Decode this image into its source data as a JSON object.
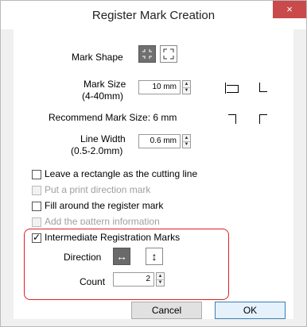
{
  "window": {
    "title": "Register Mark Creation",
    "close_glyph": "×"
  },
  "mark_shape": {
    "label": "Mark Shape",
    "options": [
      "corner-marks-icon",
      "crop-marks-icon"
    ],
    "selected_index": 0
  },
  "mark_size": {
    "label_line1": "Mark Size",
    "label_line2": "(4-40mm)",
    "value": "10 mm"
  },
  "recommend": {
    "text": "Recommend Mark Size:  6 mm"
  },
  "line_width": {
    "label_line1": "Line Width",
    "label_line2": "(0.5-2.0mm)",
    "value": "0.6 mm"
  },
  "options": [
    {
      "label": "Leave a rectangle as the cutting line",
      "checked": false,
      "enabled": true
    },
    {
      "label": "Put a print direction mark",
      "checked": false,
      "enabled": false
    },
    {
      "label": "Fill around the register mark",
      "checked": false,
      "enabled": true
    },
    {
      "label": "Add the pattern information",
      "checked": false,
      "enabled": false
    }
  ],
  "intermediate": {
    "label": "Intermediate Registration Marks",
    "checked": true,
    "direction_label": "Direction",
    "direction_options": [
      {
        "glyph": "↔",
        "name": "horizontal"
      },
      {
        "glyph": "↕",
        "name": "vertical"
      }
    ],
    "direction_selected": "horizontal",
    "count_label": "Count",
    "count_value": "2"
  },
  "buttons": {
    "cancel": "Cancel",
    "ok": "OK"
  },
  "colors": {
    "highlight": "#e02020",
    "ok_border": "#3c7fb1",
    "close": "#c94a4a"
  }
}
